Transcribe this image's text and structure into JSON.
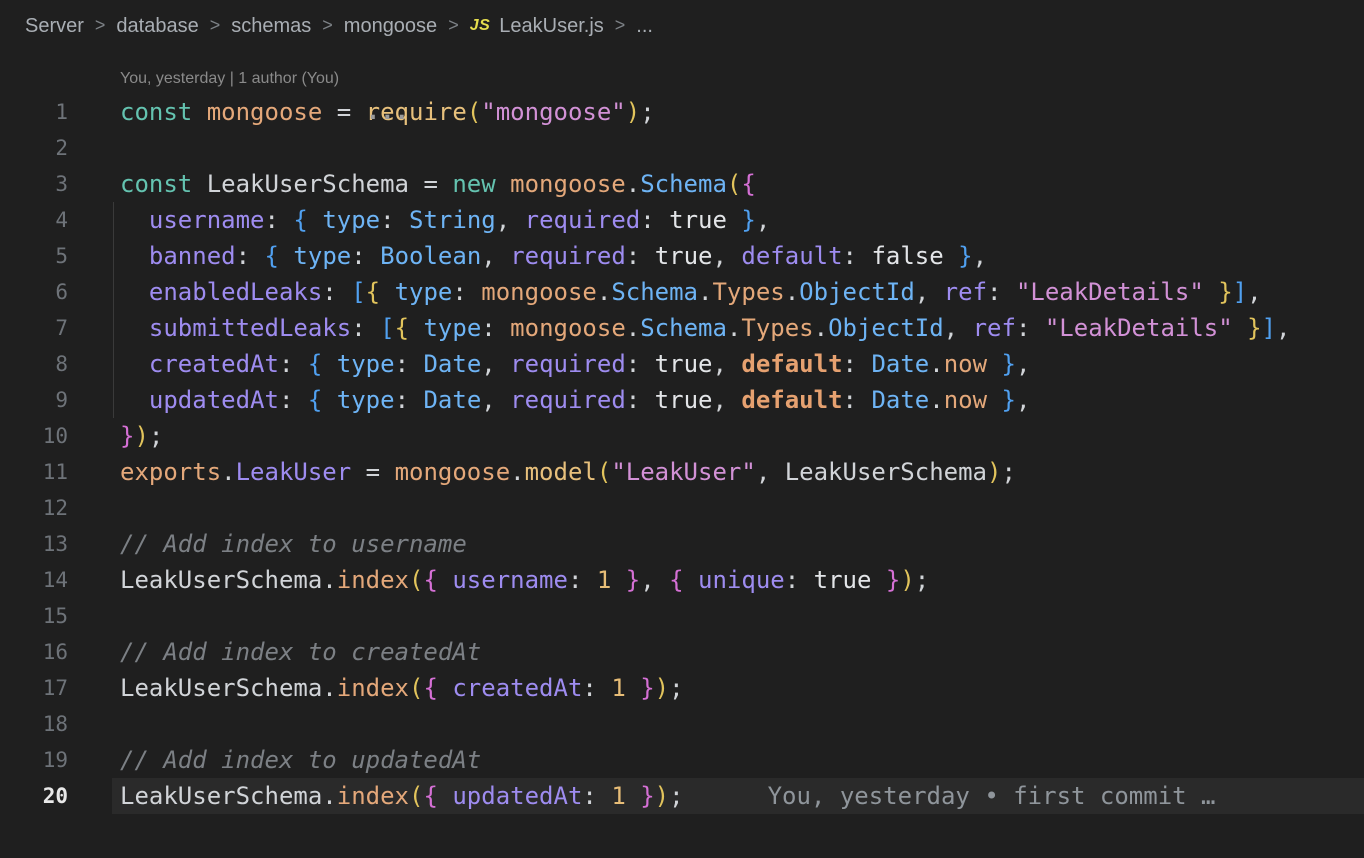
{
  "breadcrumbs": {
    "separator": ">",
    "folders": [
      "Server",
      "database",
      "schemas",
      "mongoose"
    ],
    "file": {
      "icon": "js-file-icon",
      "icon_label": "JS",
      "name": "LeakUser.js"
    },
    "overflow": "..."
  },
  "codelens": {
    "text": "You, yesterday | 1 author (You)"
  },
  "blame": {
    "line": 20,
    "text": "You, yesterday • first commit …"
  },
  "active_line": 20,
  "colors": {
    "editor_background": "#1f1f1f",
    "active_line_background": "#2a2a2a",
    "keyword": "#64c3b0",
    "variable": "#e4a87a",
    "function": "#e7c07c",
    "string": "#d291d6",
    "property": "#9e8cf0",
    "type": "#6eb4f5",
    "plain": "#d1d4d8",
    "boolean": "#e3e5e8",
    "number": "#e7bd77",
    "keyword_default": "#e6a170",
    "comment": "#7c8085",
    "bracket_gold": "#e2c45c",
    "bracket_pink": "#d570d5",
    "bracket_blue": "#50a0f0",
    "line_number": "#6e7379",
    "active_line_number": "#e8e8e8",
    "blame": "#8f959b",
    "codelens": "#8a8a8a",
    "breadcrumb_text": "#a9aeb4",
    "breadcrumb_chevron": "#7d8287",
    "js_icon": "#e5dd4e",
    "indent_guide": "#3a3a3a",
    "hint_dots": "#9a9a9a"
  },
  "code": {
    "language": "javascript",
    "lines": [
      {
        "n": 1,
        "tokens": [
          [
            "kw",
            "const"
          ],
          [
            "pln",
            " "
          ],
          [
            "var",
            "mongoose"
          ],
          [
            "pln",
            " = "
          ],
          [
            "fnh",
            "req"
          ],
          [
            "fn",
            "uire"
          ],
          [
            "b1",
            "("
          ],
          [
            "str",
            "\"mongoose\""
          ],
          [
            "b1",
            ")"
          ],
          [
            "pln",
            ";"
          ]
        ]
      },
      {
        "n": 2,
        "tokens": []
      },
      {
        "n": 3,
        "tokens": [
          [
            "kw",
            "const"
          ],
          [
            "pln",
            " LeakUserSchema = "
          ],
          [
            "kw",
            "new"
          ],
          [
            "pln",
            " "
          ],
          [
            "var",
            "mongoose"
          ],
          [
            "pln",
            "."
          ],
          [
            "type",
            "Schema"
          ],
          [
            "b1",
            "("
          ],
          [
            "b2",
            "{"
          ]
        ]
      },
      {
        "n": 4,
        "tokens": [
          [
            "pln",
            "  "
          ],
          [
            "prop",
            "username"
          ],
          [
            "pln",
            ": "
          ],
          [
            "b3",
            "{"
          ],
          [
            "pln",
            " "
          ],
          [
            "type",
            "type"
          ],
          [
            "pln",
            ": "
          ],
          [
            "type",
            "String"
          ],
          [
            "pln",
            ", "
          ],
          [
            "prop",
            "required"
          ],
          [
            "pln",
            ": "
          ],
          [
            "bool",
            "true"
          ],
          [
            "pln",
            " "
          ],
          [
            "b3",
            "}"
          ],
          [
            "pln",
            ","
          ]
        ]
      },
      {
        "n": 5,
        "tokens": [
          [
            "pln",
            "  "
          ],
          [
            "prop",
            "banned"
          ],
          [
            "pln",
            ": "
          ],
          [
            "b3",
            "{"
          ],
          [
            "pln",
            " "
          ],
          [
            "type",
            "type"
          ],
          [
            "pln",
            ": "
          ],
          [
            "type",
            "Boolean"
          ],
          [
            "pln",
            ", "
          ],
          [
            "prop",
            "required"
          ],
          [
            "pln",
            ": "
          ],
          [
            "bool",
            "true"
          ],
          [
            "pln",
            ", "
          ],
          [
            "prop",
            "default"
          ],
          [
            "pln",
            ": "
          ],
          [
            "bool",
            "false"
          ],
          [
            "pln",
            " "
          ],
          [
            "b3",
            "}"
          ],
          [
            "pln",
            ","
          ]
        ]
      },
      {
        "n": 6,
        "tokens": [
          [
            "pln",
            "  "
          ],
          [
            "prop",
            "enabledLeaks"
          ],
          [
            "pln",
            ": "
          ],
          [
            "b3",
            "["
          ],
          [
            "b4",
            "{"
          ],
          [
            "pln",
            " "
          ],
          [
            "type",
            "type"
          ],
          [
            "pln",
            ": "
          ],
          [
            "var",
            "mongoose"
          ],
          [
            "pln",
            "."
          ],
          [
            "type",
            "Schema"
          ],
          [
            "pln",
            "."
          ],
          [
            "var",
            "Types"
          ],
          [
            "pln",
            "."
          ],
          [
            "type",
            "ObjectId"
          ],
          [
            "pln",
            ", "
          ],
          [
            "prop",
            "ref"
          ],
          [
            "pln",
            ": "
          ],
          [
            "str",
            "\"LeakDetails\""
          ],
          [
            "pln",
            " "
          ],
          [
            "b4",
            "}"
          ],
          [
            "b3",
            "]"
          ],
          [
            "pln",
            ","
          ]
        ]
      },
      {
        "n": 7,
        "tokens": [
          [
            "pln",
            "  "
          ],
          [
            "prop",
            "submittedLeaks"
          ],
          [
            "pln",
            ": "
          ],
          [
            "b3",
            "["
          ],
          [
            "b4",
            "{"
          ],
          [
            "pln",
            " "
          ],
          [
            "type",
            "type"
          ],
          [
            "pln",
            ": "
          ],
          [
            "var",
            "mongoose"
          ],
          [
            "pln",
            "."
          ],
          [
            "type",
            "Schema"
          ],
          [
            "pln",
            "."
          ],
          [
            "var",
            "Types"
          ],
          [
            "pln",
            "."
          ],
          [
            "type",
            "ObjectId"
          ],
          [
            "pln",
            ", "
          ],
          [
            "prop",
            "ref"
          ],
          [
            "pln",
            ": "
          ],
          [
            "str",
            "\"LeakDetails\""
          ],
          [
            "pln",
            " "
          ],
          [
            "b4",
            "}"
          ],
          [
            "b3",
            "]"
          ],
          [
            "pln",
            ","
          ]
        ]
      },
      {
        "n": 8,
        "tokens": [
          [
            "pln",
            "  "
          ],
          [
            "prop",
            "createdAt"
          ],
          [
            "pln",
            ": "
          ],
          [
            "b3",
            "{"
          ],
          [
            "pln",
            " "
          ],
          [
            "type",
            "type"
          ],
          [
            "pln",
            ": "
          ],
          [
            "type",
            "Date"
          ],
          [
            "pln",
            ", "
          ],
          [
            "prop",
            "required"
          ],
          [
            "pln",
            ": "
          ],
          [
            "bool",
            "true"
          ],
          [
            "pln",
            ", "
          ],
          [
            "dkw",
            "default"
          ],
          [
            "pln",
            ": "
          ],
          [
            "type",
            "Date"
          ],
          [
            "pln",
            "."
          ],
          [
            "var",
            "now"
          ],
          [
            "pln",
            " "
          ],
          [
            "b3",
            "}"
          ],
          [
            "pln",
            ","
          ]
        ]
      },
      {
        "n": 9,
        "tokens": [
          [
            "pln",
            "  "
          ],
          [
            "prop",
            "updatedAt"
          ],
          [
            "pln",
            ": "
          ],
          [
            "b3",
            "{"
          ],
          [
            "pln",
            " "
          ],
          [
            "type",
            "type"
          ],
          [
            "pln",
            ": "
          ],
          [
            "type",
            "Date"
          ],
          [
            "pln",
            ", "
          ],
          [
            "prop",
            "required"
          ],
          [
            "pln",
            ": "
          ],
          [
            "bool",
            "true"
          ],
          [
            "pln",
            ", "
          ],
          [
            "dkw",
            "default"
          ],
          [
            "pln",
            ": "
          ],
          [
            "type",
            "Date"
          ],
          [
            "pln",
            "."
          ],
          [
            "var",
            "now"
          ],
          [
            "pln",
            " "
          ],
          [
            "b3",
            "}"
          ],
          [
            "pln",
            ","
          ]
        ]
      },
      {
        "n": 10,
        "tokens": [
          [
            "b2",
            "}"
          ],
          [
            "b1",
            ")"
          ],
          [
            "pln",
            ";"
          ]
        ]
      },
      {
        "n": 11,
        "tokens": [
          [
            "var",
            "exports"
          ],
          [
            "pln",
            "."
          ],
          [
            "prop",
            "LeakUser"
          ],
          [
            "pln",
            " = "
          ],
          [
            "var",
            "mongoose"
          ],
          [
            "pln",
            "."
          ],
          [
            "fn",
            "model"
          ],
          [
            "b1",
            "("
          ],
          [
            "str",
            "\"LeakUser\""
          ],
          [
            "pln",
            ", LeakUserSchema"
          ],
          [
            "b1",
            ")"
          ],
          [
            "pln",
            ";"
          ]
        ]
      },
      {
        "n": 12,
        "tokens": []
      },
      {
        "n": 13,
        "tokens": [
          [
            "cmt",
            "// Add index to username"
          ]
        ]
      },
      {
        "n": 14,
        "tokens": [
          [
            "pln",
            "LeakUserSchema."
          ],
          [
            "var",
            "index"
          ],
          [
            "b1",
            "("
          ],
          [
            "b2",
            "{"
          ],
          [
            "pln",
            " "
          ],
          [
            "prop",
            "username"
          ],
          [
            "pln",
            ": "
          ],
          [
            "num",
            "1"
          ],
          [
            "pln",
            " "
          ],
          [
            "b2",
            "}"
          ],
          [
            "pln",
            ", "
          ],
          [
            "b2",
            "{"
          ],
          [
            "pln",
            " "
          ],
          [
            "prop",
            "unique"
          ],
          [
            "pln",
            ": "
          ],
          [
            "bool",
            "true"
          ],
          [
            "pln",
            " "
          ],
          [
            "b2",
            "}"
          ],
          [
            "b1",
            ")"
          ],
          [
            "pln",
            ";"
          ]
        ]
      },
      {
        "n": 15,
        "tokens": []
      },
      {
        "n": 16,
        "tokens": [
          [
            "cmt",
            "// Add index to createdAt"
          ]
        ]
      },
      {
        "n": 17,
        "tokens": [
          [
            "pln",
            "LeakUserSchema."
          ],
          [
            "var",
            "index"
          ],
          [
            "b1",
            "("
          ],
          [
            "b2",
            "{"
          ],
          [
            "pln",
            " "
          ],
          [
            "prop",
            "createdAt"
          ],
          [
            "pln",
            ": "
          ],
          [
            "num",
            "1"
          ],
          [
            "pln",
            " "
          ],
          [
            "b2",
            "}"
          ],
          [
            "b1",
            ")"
          ],
          [
            "pln",
            ";"
          ]
        ]
      },
      {
        "n": 18,
        "tokens": []
      },
      {
        "n": 19,
        "tokens": [
          [
            "cmt",
            "// Add index to updatedAt"
          ]
        ]
      },
      {
        "n": 20,
        "tokens": [
          [
            "pln",
            "LeakUserSchema."
          ],
          [
            "var",
            "index"
          ],
          [
            "b1",
            "("
          ],
          [
            "b2",
            "{"
          ],
          [
            "pln",
            " "
          ],
          [
            "prop",
            "updatedAt"
          ],
          [
            "pln",
            ": "
          ],
          [
            "num",
            "1"
          ],
          [
            "pln",
            " "
          ],
          [
            "b2",
            "}"
          ],
          [
            "b1",
            ")"
          ],
          [
            "pln",
            ";"
          ]
        ]
      }
    ]
  }
}
